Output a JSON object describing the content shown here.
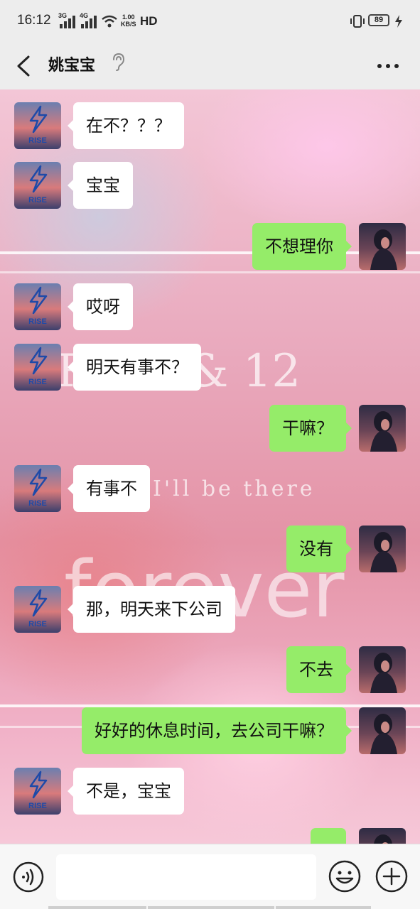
{
  "status_bar": {
    "time": "16:12",
    "network_1": "3G",
    "network_2": "4G",
    "speed_value": "1.00",
    "speed_unit": "KB/S",
    "hd_label": "HD",
    "battery": "89"
  },
  "header": {
    "title": "姚宝宝",
    "back_icon": "chevron-left-icon",
    "ear_icon": "ear-icon",
    "more_icon": "more-dots-icon"
  },
  "background": {
    "text_line1": "RISE & 12",
    "text_line2": "I'll be there",
    "text_line3": "forever"
  },
  "contact_avatar_text": "RISE",
  "messages": [
    {
      "side": "in",
      "text": "在不？？？"
    },
    {
      "side": "in",
      "text": "宝宝"
    },
    {
      "side": "out",
      "text": "不想理你"
    },
    {
      "side": "in",
      "text": "哎呀"
    },
    {
      "side": "in",
      "text": "明天有事不？"
    },
    {
      "side": "out",
      "text": "干嘛？"
    },
    {
      "side": "in",
      "text": "有事不"
    },
    {
      "side": "out",
      "text": "没有"
    },
    {
      "side": "in",
      "text": "那，明天来下公司"
    },
    {
      "side": "out",
      "text": "不去"
    },
    {
      "side": "out",
      "text": "好好的休息时间，去公司干嘛？"
    },
    {
      "side": "in",
      "text": "不是，宝宝"
    },
    {
      "side": "out",
      "text": ""
    }
  ],
  "input_bar": {
    "voice_icon": "voice-icon",
    "input_value": "",
    "emoji_icon": "emoji-icon",
    "plus_icon": "plus-icon"
  },
  "colors": {
    "incoming_bubble": "#ffffff",
    "outgoing_bubble": "#95ec69",
    "bar_background": "#ededed"
  }
}
